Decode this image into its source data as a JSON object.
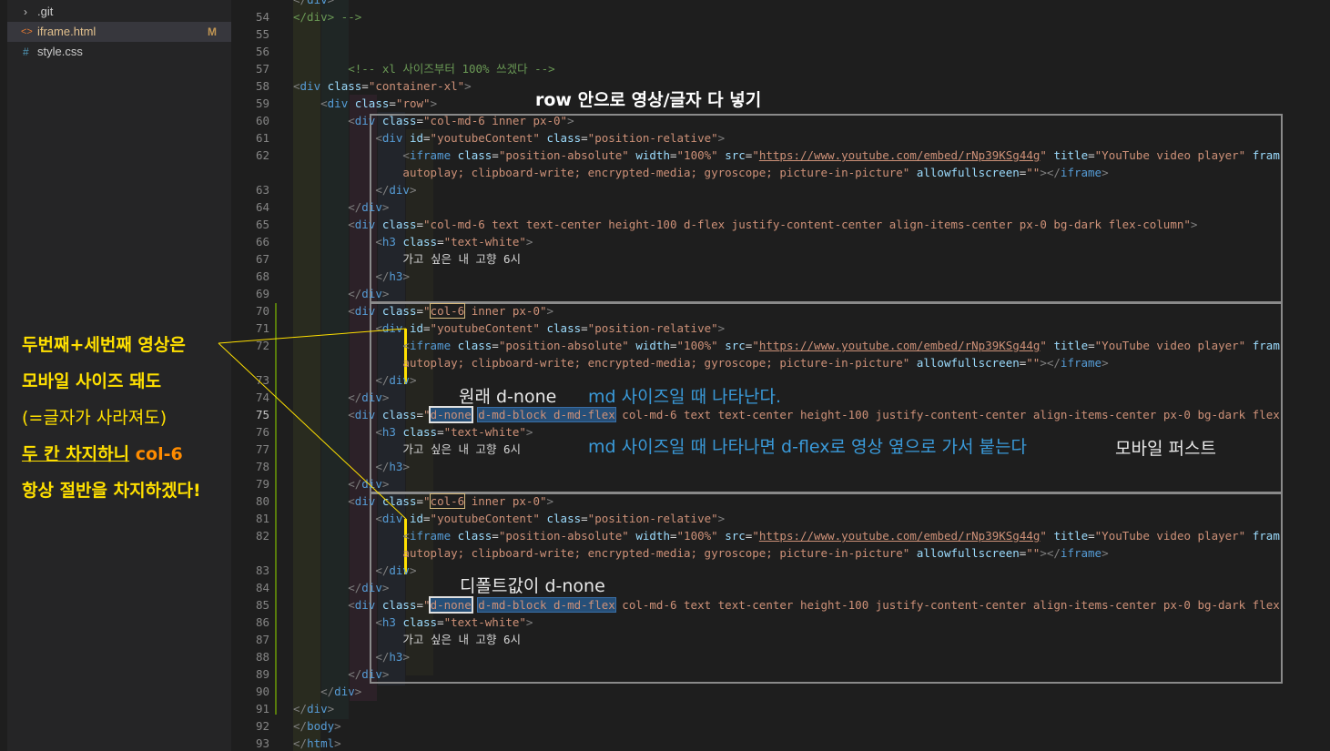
{
  "explorer": {
    "items": [
      {
        "icon": "folder-chevron-icon",
        "glyph": "›",
        "name": ".git",
        "status": ""
      },
      {
        "icon": "html-file-icon",
        "glyph": "<>",
        "name": "iframe.html",
        "status": "M"
      },
      {
        "icon": "css-file-icon",
        "glyph": "#",
        "name": "style.css",
        "status": ""
      }
    ]
  },
  "annotations": {
    "left": {
      "line1": "두번째+세번째 영상은",
      "line2": "모바일 사이즈 돼도",
      "line3": "(=글자가 사라져도)",
      "line4a": "두 칸 차지하니",
      "line4b": "col-6",
      "line5": "항상 절반을 차지하겠다!"
    },
    "row_note": "row 안으로 영상/글자 다 넣기",
    "original_dnone": "원래 d-none",
    "md_appear": "md 사이즈일 때 나타난다.",
    "md_flex": "md 사이즈일 때 나타나면 d-flex로 영상 옆으로 가서 붙는다",
    "mobile_first": "모바일 퍼스트",
    "default_dnone": "디폴트값이 d-none"
  },
  "colors": {
    "annotation_yellow": "#ffe000",
    "annotation_orange": "#ff8c00",
    "annotation_blue": "#3a9ad9",
    "annotation_white": "#e8e8e8"
  },
  "code": {
    "lines": [
      {
        "n": "",
        "html": "<span class=\"tag\">&lt;/</span><span class=\"tn\">div</span><span class=\"tag\">&gt;</span>"
      },
      {
        "n": "54",
        "html": "<span class=\"cm\">&lt;/div&gt; --&gt;</span>"
      },
      {
        "n": "55",
        "html": ""
      },
      {
        "n": "56",
        "html": ""
      },
      {
        "n": "57",
        "html": "        <span class=\"cm\">&lt;!-- xl 사이즈부터 100% 쓰겠다 --&gt;</span>"
      },
      {
        "n": "58",
        "html": "<span class=\"tag\">&lt;</span><span class=\"tn\">div</span> <span class=\"an\">class</span>=<span class=\"av\">\"container-xl\"</span><span class=\"tag\">&gt;</span>"
      },
      {
        "n": "59",
        "html": "    <span class=\"tag\">&lt;</span><span class=\"tn\">div</span> <span class=\"an\">class</span>=<span class=\"av\">\"row\"</span><span class=\"tag\">&gt;</span>"
      },
      {
        "n": "60",
        "html": "        <span class=\"tag\">&lt;</span><span class=\"tn\">div</span> <span class=\"an\">class</span>=<span class=\"av\">\"col-md-6 inner px-0\"</span><span class=\"tag\">&gt;</span>"
      },
      {
        "n": "61",
        "html": "            <span class=\"tag\">&lt;</span><span class=\"tn\">div</span> <span class=\"an\">id</span>=<span class=\"av\">\"youtubeContent\"</span> <span class=\"an\">class</span>=<span class=\"av\">\"position-relative\"</span><span class=\"tag\">&gt;</span>"
      },
      {
        "n": "62",
        "html": "                <span class=\"tag\">&lt;</span><span class=\"tn\">iframe</span> <span class=\"an\">class</span>=<span class=\"av\">\"position-absolute\"</span> <span class=\"an\">width</span>=<span class=\"av\">\"100%\"</span> <span class=\"an\">src</span>=<span class=\"av\">\"</span><span class=\"link\">https://www.youtube.com/embed/rNp39KSg44g</span><span class=\"av\">\"</span> <span class=\"an\">title</span>=<span class=\"av\">\"YouTube video player\"</span> <span class=\"an\">fram</span>"
      },
      {
        "n": "",
        "html": "                <span class=\"av\">autoplay; clipboard-write; encrypted-media; gyroscope; picture-in-picture\"</span> <span class=\"an\">allowfullscreen</span>=<span class=\"av\">\"\"</span><span class=\"tag\">&gt;&lt;/</span><span class=\"tn\">iframe</span><span class=\"tag\">&gt;</span>"
      },
      {
        "n": "63",
        "html": "            <span class=\"tag\">&lt;/</span><span class=\"tn\">div</span><span class=\"tag\">&gt;</span>"
      },
      {
        "n": "64",
        "html": "        <span class=\"tag\">&lt;/</span><span class=\"tn\">div</span><span class=\"tag\">&gt;</span>"
      },
      {
        "n": "65",
        "html": "        <span class=\"tag\">&lt;</span><span class=\"tn\">div</span> <span class=\"an\">class</span>=<span class=\"av\">\"col-md-6 text text-center height-100 d-flex justify-content-center align-items-center px-0 bg-dark flex-column\"</span><span class=\"tag\">&gt;</span>"
      },
      {
        "n": "66",
        "html": "            <span class=\"tag\">&lt;</span><span class=\"tn\">h3</span> <span class=\"an\">class</span>=<span class=\"av\">\"text-white\"</span><span class=\"tag\">&gt;</span>"
      },
      {
        "n": "67",
        "html": "                <span class=\"tx\">가고 싶은 내 고향 6시</span>"
      },
      {
        "n": "68",
        "html": "            <span class=\"tag\">&lt;/</span><span class=\"tn\">h3</span><span class=\"tag\">&gt;</span>"
      },
      {
        "n": "69",
        "html": "        <span class=\"tag\">&lt;/</span><span class=\"tn\">div</span><span class=\"tag\">&gt;</span>"
      },
      {
        "n": "70",
        "html": "        <span class=\"tag\">&lt;</span><span class=\"tn\">div</span> <span class=\"an\">class</span>=<span class=\"av\">\"<span class=\"hl-yellow\">col-6</span> inner px-0\"</span><span class=\"tag\">&gt;</span>"
      },
      {
        "n": "71",
        "html": "            <span class=\"tag\">&lt;</span><span class=\"tn\">div</span> <span class=\"an\">id</span>=<span class=\"av\">\"youtubeContent\"</span> <span class=\"an\">class</span>=<span class=\"av\">\"position-relative\"</span><span class=\"tag\">&gt;</span>"
      },
      {
        "n": "72",
        "html": "                <span class=\"tag\">&lt;</span><span class=\"tn\">iframe</span> <span class=\"an\">class</span>=<span class=\"av\">\"position-absolute\"</span> <span class=\"an\">width</span>=<span class=\"av\">\"100%\"</span> <span class=\"an\">src</span>=<span class=\"av\">\"</span><span class=\"link\">https://www.youtube.com/embed/rNp39KSg44g</span><span class=\"av\">\"</span> <span class=\"an\">title</span>=<span class=\"av\">\"YouTube video player\"</span> <span class=\"an\">fram</span>"
      },
      {
        "n": "",
        "html": "                <span class=\"av\">autoplay; clipboard-write; encrypted-media; gyroscope; picture-in-picture\"</span> <span class=\"an\">allowfullscreen</span>=<span class=\"av\">\"\"</span><span class=\"tag\">&gt;&lt;/</span><span class=\"tn\">iframe</span><span class=\"tag\">&gt;</span>"
      },
      {
        "n": "73",
        "html": "            <span class=\"tag\">&lt;/</span><span class=\"tn\">div</span><span class=\"tag\">&gt;</span>"
      },
      {
        "n": "74",
        "html": "        <span class=\"tag\">&lt;/</span><span class=\"tn\">div</span><span class=\"tag\">&gt;</span>"
      },
      {
        "n": "75",
        "html": "        <span class=\"tag\">&lt;</span><span class=\"tn\">div</span> <span class=\"an\">class</span>=<span class=\"av\">\"<span class=\"hl-white\">d-none</span> <span class=\"hl-blue\">d-md-block d-md-flex</span> col-md-6 text text-center height-100 justify-content-center align-items-center px-0 bg-dark flex</span>"
      },
      {
        "n": "76",
        "html": "            <span class=\"tag\">&lt;</span><span class=\"tn\">h3</span> <span class=\"an\">class</span>=<span class=\"av\">\"text-white\"</span><span class=\"tag\">&gt;</span>"
      },
      {
        "n": "77",
        "html": "                <span class=\"tx\">가고 싶은 내 고향 6시</span>"
      },
      {
        "n": "78",
        "html": "            <span class=\"tag\">&lt;/</span><span class=\"tn\">h3</span><span class=\"tag\">&gt;</span>"
      },
      {
        "n": "79",
        "html": "        <span class=\"tag\">&lt;/</span><span class=\"tn\">div</span><span class=\"tag\">&gt;</span>"
      },
      {
        "n": "80",
        "html": "        <span class=\"tag\">&lt;</span><span class=\"tn\">div</span> <span class=\"an\">class</span>=<span class=\"av\">\"<span class=\"hl-yellow\">col-6</span> inner px-0\"</span><span class=\"tag\">&gt;</span>"
      },
      {
        "n": "81",
        "html": "            <span class=\"tag\">&lt;</span><span class=\"tn\">div</span> <span class=\"an\">id</span>=<span class=\"av\">\"youtubeContent\"</span> <span class=\"an\">class</span>=<span class=\"av\">\"position-relative\"</span><span class=\"tag\">&gt;</span>"
      },
      {
        "n": "82",
        "html": "                <span class=\"tag\">&lt;</span><span class=\"tn\">iframe</span> <span class=\"an\">class</span>=<span class=\"av\">\"position-absolute\"</span> <span class=\"an\">width</span>=<span class=\"av\">\"100%\"</span> <span class=\"an\">src</span>=<span class=\"av\">\"</span><span class=\"link\">https://www.youtube.com/embed/rNp39KSg44g</span><span class=\"av\">\"</span> <span class=\"an\">title</span>=<span class=\"av\">\"YouTube video player\"</span> <span class=\"an\">fram</span>"
      },
      {
        "n": "",
        "html": "                <span class=\"av\">autoplay; clipboard-write; encrypted-media; gyroscope; picture-in-picture\"</span> <span class=\"an\">allowfullscreen</span>=<span class=\"av\">\"\"</span><span class=\"tag\">&gt;&lt;/</span><span class=\"tn\">iframe</span><span class=\"tag\">&gt;</span>"
      },
      {
        "n": "83",
        "html": "            <span class=\"tag\">&lt;/</span><span class=\"tn\">div</span><span class=\"tag\">&gt;</span>"
      },
      {
        "n": "84",
        "html": "        <span class=\"tag\">&lt;/</span><span class=\"tn\">div</span><span class=\"tag\">&gt;</span>"
      },
      {
        "n": "85",
        "html": "        <span class=\"tag\">&lt;</span><span class=\"tn\">div</span> <span class=\"an\">class</span>=<span class=\"av\">\"<span class=\"hl-white\">d-none</span> <span class=\"hl-blue\">d-md-block d-md-flex</span> col-md-6 text text-center height-100 justify-content-center align-items-center px-0 bg-dark flex</span>"
      },
      {
        "n": "86",
        "html": "            <span class=\"tag\">&lt;</span><span class=\"tn\">h3</span> <span class=\"an\">class</span>=<span class=\"av\">\"text-white\"</span><span class=\"tag\">&gt;</span>"
      },
      {
        "n": "87",
        "html": "                <span class=\"tx\">가고 싶은 내 고향 6시</span>"
      },
      {
        "n": "88",
        "html": "            <span class=\"tag\">&lt;/</span><span class=\"tn\">h3</span><span class=\"tag\">&gt;</span>"
      },
      {
        "n": "89",
        "html": "        <span class=\"tag\">&lt;/</span><span class=\"tn\">div</span><span class=\"tag\">&gt;</span>"
      },
      {
        "n": "90",
        "html": "    <span class=\"tag\">&lt;/</span><span class=\"tn\">div</span><span class=\"tag\">&gt;</span>"
      },
      {
        "n": "91",
        "html": "<span class=\"tag\">&lt;/</span><span class=\"tn\">div</span><span class=\"tag\">&gt;</span>"
      },
      {
        "n": "92",
        "html": "<span class=\"tag\">&lt;/</span><span class=\"tn\">body</span><span class=\"tag\">&gt;</span>"
      },
      {
        "n": "93",
        "html": "<span class=\"tag\">&lt;/</span><span class=\"tn\">html</span><span class=\"tag\">&gt;</span>"
      }
    ]
  }
}
